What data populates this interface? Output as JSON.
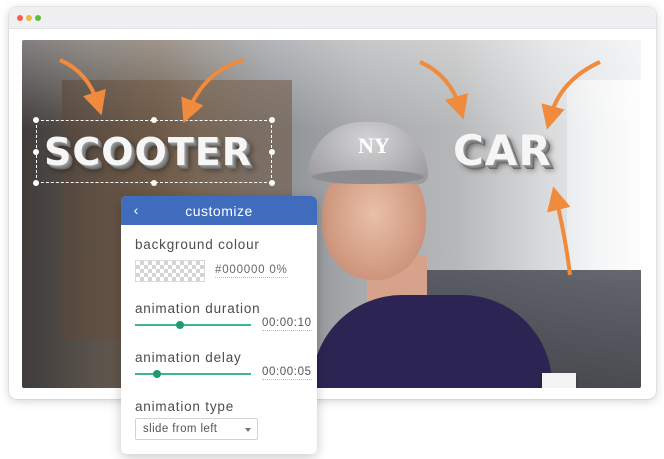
{
  "video": {
    "overlay_words": {
      "scooter": "SCOOTER",
      "car": "CAR"
    },
    "cap_logo": "NY"
  },
  "panel": {
    "title": "customize",
    "back_icon": "chevron-left-icon",
    "background_colour": {
      "label": "background colour",
      "value": "#000000",
      "opacity": "0%"
    },
    "animation_duration": {
      "label": "animation duration",
      "value": "00:00:10",
      "slider_fraction": 0.39
    },
    "animation_delay": {
      "label": "animation delay",
      "value": "00:00:05",
      "slider_fraction": 0.19
    },
    "animation_type": {
      "label": "animation type",
      "selected": "slide from left"
    }
  },
  "colors": {
    "accent": "#3f6cbc",
    "slider": "#1f9c6d",
    "arrows": "#f08a3c"
  }
}
